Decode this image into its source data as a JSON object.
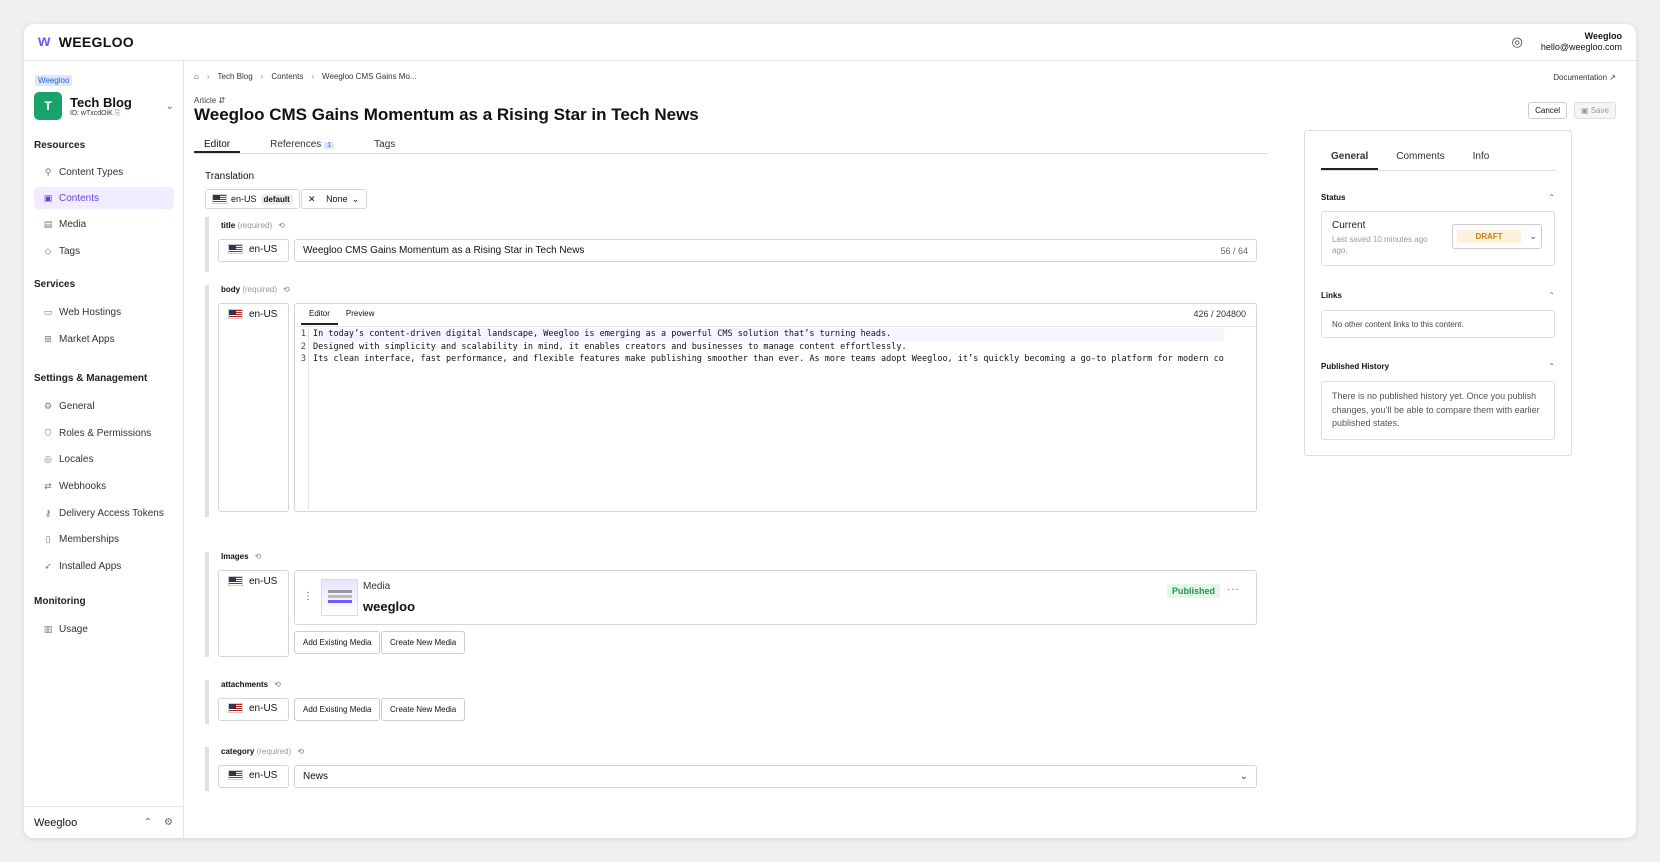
{
  "app": {
    "brand": "WEEGLOO",
    "user_name": "Weegloo",
    "user_email": "hello@weegloo.com"
  },
  "sidebar": {
    "workspace_tag": "Weegloo",
    "workspace_initial": "T",
    "workspace_name": "Tech Blog",
    "workspace_id": "ID: wTxcdOiK",
    "sections": {
      "resources": "Resources",
      "services": "Services",
      "settings": "Settings & Management",
      "monitoring": "Monitoring"
    },
    "items": {
      "content_types": "Content Types",
      "contents": "Contents",
      "media": "Media",
      "tags": "Tags",
      "web_hostings": "Web Hostings",
      "market_apps": "Market Apps",
      "general": "General",
      "roles": "Roles & Permissions",
      "locales": "Locales",
      "webhooks": "Webhooks",
      "tokens": "Delivery Access Tokens",
      "memberships": "Memberships",
      "installed_apps": "Installed Apps",
      "usage": "Usage"
    },
    "footer_name": "Weegloo"
  },
  "breadcrumb": {
    "items": [
      "Tech Blog",
      "Contents",
      "Weegloo CMS Gains Mo..."
    ],
    "doc_link": "Documentation"
  },
  "header": {
    "kind": "Article ⇵",
    "title": "Weegloo CMS Gains Momentum as a Rising Star in Tech News",
    "cancel": "Cancel",
    "save": "Save"
  },
  "tabs": {
    "editor": "Editor",
    "references": "References",
    "references_count": "1",
    "tags": "Tags"
  },
  "translation": {
    "label": "Translation",
    "locale": "en-US",
    "default_badge": "default",
    "none_label": "None"
  },
  "fields": {
    "title": {
      "label": "title",
      "req": "(required)",
      "locale": "en-US",
      "value": "Weegloo CMS Gains Momentum as a Rising Star in Tech News",
      "count": "56 / 64"
    },
    "body": {
      "label": "body",
      "req": "(required)",
      "locale": "en-US",
      "tab_editor": "Editor",
      "tab_preview": "Preview",
      "count": "426 / 204800",
      "line_numbers": [
        "1",
        "2",
        "3"
      ],
      "lines": [
        "In today’s content-driven digital landscape, Weegloo is emerging as a powerful CMS solution that’s turning heads.",
        "Designed with simplicity and scalability in mind, it enables creators and businesses to manage content effortlessly.",
        "Its clean interface, fast performance, and flexible features make publishing smoother than ever. As more teams adopt Weegloo, it’s quickly becoming a go-to platform for modern co"
      ]
    },
    "images": {
      "label": "Images",
      "locale": "en-US",
      "media_kind": "Media",
      "media_name": "weegloo",
      "status": "Published",
      "add_existing": "Add Existing Media",
      "create_new": "Create New Media"
    },
    "attachments": {
      "label": "attachments",
      "locale": "en-US",
      "add_existing": "Add Existing Media",
      "create_new": "Create New Media"
    },
    "category": {
      "label": "category",
      "req": "(required)",
      "locale": "en-US",
      "value": "News"
    }
  },
  "panel": {
    "tabs": {
      "general": "General",
      "comments": "Comments",
      "info": "Info"
    },
    "status": {
      "title": "Status",
      "current": "Current",
      "saved": "Last saved 10 minutes ago ago.",
      "value": "DRAFT"
    },
    "links": {
      "title": "Links",
      "empty": "No other content links to this content."
    },
    "history": {
      "title": "Published History",
      "empty": "There is no published history yet. Once you publish changes, you’ll be able to compare them with earlier published states."
    }
  },
  "colors": {
    "accent": "#6a3fd8",
    "published": "#1f9550",
    "draft": "#c98010"
  }
}
